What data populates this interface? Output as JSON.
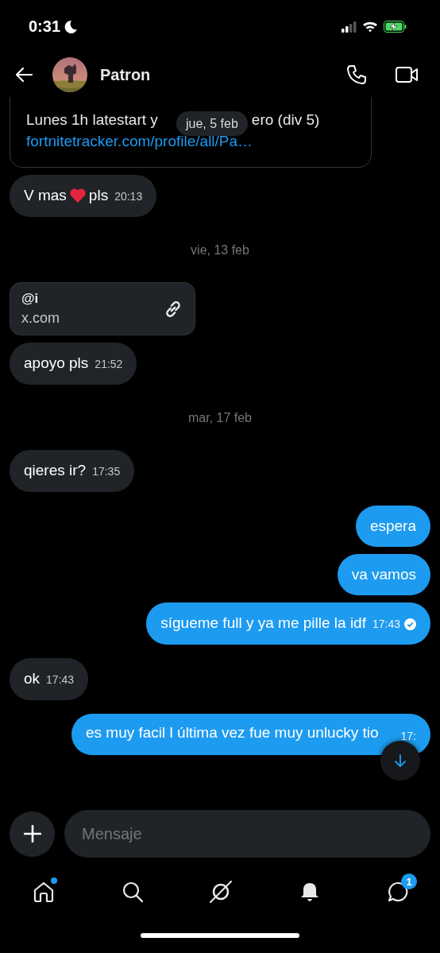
{
  "status_bar": {
    "time": "0:31"
  },
  "header": {
    "name": "Patron"
  },
  "sticky_date": "jue, 5 feb",
  "messages": [
    {
      "kind": "card",
      "line_2_start": "Lunes 1h latestart y",
      "line_2_end": "ero (div 5)",
      "link": "fortnitetracker.com/profile/all/Pa…"
    },
    {
      "kind": "received",
      "segments": [
        {
          "kind": "text",
          "text": "V mas"
        },
        {
          "kind": "heart"
        },
        {
          "kind": "text",
          "text": "pls"
        }
      ],
      "time": "20:13"
    },
    {
      "kind": "date",
      "text": "vie, 13 feb"
    },
    {
      "kind": "link_card",
      "title": "@i",
      "domain": "x.com"
    },
    {
      "kind": "received",
      "segments": [
        {
          "kind": "text",
          "text": "apoyo pls"
        }
      ],
      "time": "21:52"
    },
    {
      "kind": "date",
      "text": "mar, 17 feb"
    },
    {
      "kind": "received",
      "segments": [
        {
          "kind": "text",
          "text": "qieres ir?"
        }
      ],
      "time": "17:35"
    },
    {
      "kind": "sent",
      "segments": [
        {
          "kind": "text",
          "text": "espera"
        }
      ]
    },
    {
      "kind": "sent",
      "segments": [
        {
          "kind": "text",
          "text": "va vamos"
        }
      ]
    },
    {
      "kind": "sent",
      "segments": [
        {
          "kind": "text",
          "text": "sígueme full y ya me pille la idf"
        }
      ],
      "time": "17:43",
      "seen": true
    },
    {
      "kind": "received",
      "segments": [
        {
          "kind": "text",
          "text": "ok"
        }
      ],
      "time": "17:43"
    },
    {
      "kind": "sent",
      "segments": [
        {
          "kind": "text",
          "text": "es muy facil l última vez fue muy unlucky tio"
        }
      ],
      "time": "17:"
    }
  ],
  "composer": {
    "placeholder": "Mensaje"
  },
  "tab_bar": [
    {
      "kind": "home",
      "dot": true
    },
    {
      "kind": "search"
    },
    {
      "kind": "spark"
    },
    {
      "kind": "bell"
    },
    {
      "kind": "messages",
      "badge": "1"
    }
  ]
}
